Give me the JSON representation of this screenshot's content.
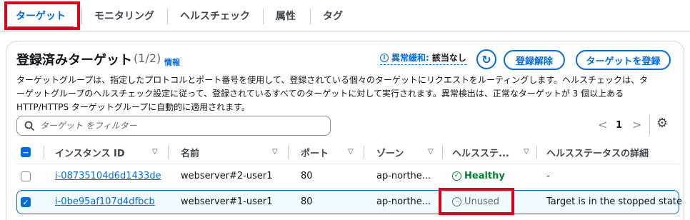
{
  "tabs": [
    {
      "label": "ターゲット",
      "active": true
    },
    {
      "label": "モニタリング"
    },
    {
      "label": "ヘルスチェック"
    },
    {
      "label": "属性"
    },
    {
      "label": "タグ"
    }
  ],
  "panel": {
    "title": "登録済みターゲット",
    "count": "(1/2)",
    "info_link": "情報",
    "anomaly_label": "異常緩和:",
    "anomaly_value": "該当なし",
    "deregister_label": "登録解除",
    "register_label": "ターゲットを登録",
    "description": [
      "ターゲットグループは、指定したプロトコルとポート番号を使用して、登録されている個々のターゲットにリクエストをルーティングします。ヘルスチェックは、タ",
      "ーゲットグループのヘルスチェック設定に従って、登録されているすべてのターゲットに対して実行されます。異常検出は、正常なターゲットが 3 個以上ある",
      "HTTP/HTTPS ターゲットグループに自動的に適用されます。"
    ],
    "filter_placeholder": "ターゲット をフィルター",
    "page_number": "1"
  },
  "table": {
    "columns": [
      "インスタンス ID",
      "名前",
      "ポート",
      "ゾーン",
      "ヘルスステ...",
      "ヘルスステータスの詳細"
    ],
    "rows": [
      {
        "selected": false,
        "instance_id": "i-08735104d6d1433de",
        "name": "webserver#2-user1",
        "port": "80",
        "zone": "ap-northe...",
        "health": "Healthy",
        "health_state": "healthy",
        "details": "-"
      },
      {
        "selected": true,
        "instance_id": "i-0be95af107d4dfbcb",
        "name": "webserver#1-user1",
        "port": "80",
        "zone": "ap-northe...",
        "health": "Unused",
        "health_state": "unused",
        "details": "Target is in the stopped state"
      }
    ]
  },
  "colors": {
    "accent": "#006ce0",
    "highlight_box": "#e0001a",
    "healthy": "#00802f",
    "unused": "#5f6b7a"
  },
  "icons": [
    "info-circle-icon",
    "refresh-icon",
    "search-icon",
    "chevron-left-icon",
    "chevron-right-icon",
    "gear-icon",
    "sort-down-icon",
    "check-circle-icon",
    "ellipsis-circle-icon"
  ]
}
